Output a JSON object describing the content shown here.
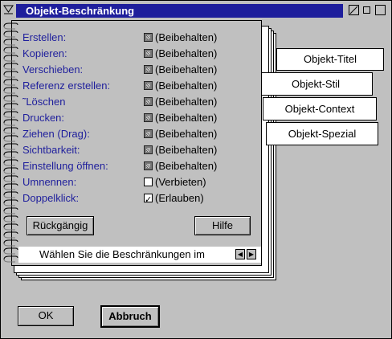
{
  "window": {
    "title": "Objekt-Beschränkung"
  },
  "rows": [
    {
      "label": "Erstellen:",
      "state": "mixed",
      "value": "(Beibehalten)"
    },
    {
      "label": "Kopieren:",
      "state": "mixed",
      "value": "(Beibehalten)"
    },
    {
      "label": "Verschieben:",
      "state": "mixed",
      "value": "(Beibehalten)"
    },
    {
      "label": "Referenz erstellen:",
      "state": "mixed",
      "value": "(Beibehalten)"
    },
    {
      "label": "˜Löschen",
      "state": "mixed",
      "value": "(Beibehalten)"
    },
    {
      "label": "Drucken:",
      "state": "mixed",
      "value": "(Beibehalten)"
    },
    {
      "label": "Ziehen (Drag):",
      "state": "mixed",
      "value": "(Beibehalten)"
    },
    {
      "label": "Sichtbarkeit:",
      "state": "mixed",
      "value": "(Beibehalten)"
    },
    {
      "label": "Einstellung öffnen:",
      "state": "mixed",
      "value": "(Beibehalten)"
    },
    {
      "label": "Umnennen:",
      "state": "empty",
      "value": "(Verbieten)"
    },
    {
      "label": "Doppelklick:",
      "state": "check",
      "value": "(Erlauben)"
    }
  ],
  "buttons": {
    "undo": "Rückgängig",
    "help": "Hilfe",
    "ok": "OK",
    "cancel": "Abbruch"
  },
  "status": {
    "text": "Wählen Sie die Beschränkungen im"
  },
  "tabs": [
    "Objekt-Titel",
    "Objekt-Stil",
    "Objekt-Context",
    "Objekt-Spezial"
  ],
  "colors": {
    "title_bar": "#1e1e9c",
    "label_text": "#1e1e9c",
    "background": "#c0c0c0"
  }
}
